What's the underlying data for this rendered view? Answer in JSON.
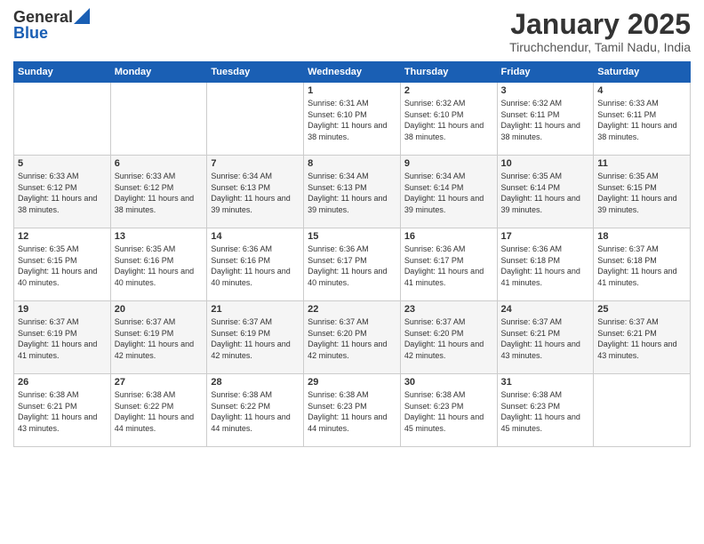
{
  "header": {
    "logo_general": "General",
    "logo_blue": "Blue",
    "month": "January 2025",
    "location": "Tiruchchendur, Tamil Nadu, India"
  },
  "days_of_week": [
    "Sunday",
    "Monday",
    "Tuesday",
    "Wednesday",
    "Thursday",
    "Friday",
    "Saturday"
  ],
  "weeks": [
    [
      {
        "day": "",
        "text": ""
      },
      {
        "day": "",
        "text": ""
      },
      {
        "day": "",
        "text": ""
      },
      {
        "day": "1",
        "text": "Sunrise: 6:31 AM\nSunset: 6:10 PM\nDaylight: 11 hours\nand 38 minutes."
      },
      {
        "day": "2",
        "text": "Sunrise: 6:32 AM\nSunset: 6:10 PM\nDaylight: 11 hours\nand 38 minutes."
      },
      {
        "day": "3",
        "text": "Sunrise: 6:32 AM\nSunset: 6:11 PM\nDaylight: 11 hours\nand 38 minutes."
      },
      {
        "day": "4",
        "text": "Sunrise: 6:33 AM\nSunset: 6:11 PM\nDaylight: 11 hours\nand 38 minutes."
      }
    ],
    [
      {
        "day": "5",
        "text": "Sunrise: 6:33 AM\nSunset: 6:12 PM\nDaylight: 11 hours\nand 38 minutes."
      },
      {
        "day": "6",
        "text": "Sunrise: 6:33 AM\nSunset: 6:12 PM\nDaylight: 11 hours\nand 38 minutes."
      },
      {
        "day": "7",
        "text": "Sunrise: 6:34 AM\nSunset: 6:13 PM\nDaylight: 11 hours\nand 39 minutes."
      },
      {
        "day": "8",
        "text": "Sunrise: 6:34 AM\nSunset: 6:13 PM\nDaylight: 11 hours\nand 39 minutes."
      },
      {
        "day": "9",
        "text": "Sunrise: 6:34 AM\nSunset: 6:14 PM\nDaylight: 11 hours\nand 39 minutes."
      },
      {
        "day": "10",
        "text": "Sunrise: 6:35 AM\nSunset: 6:14 PM\nDaylight: 11 hours\nand 39 minutes."
      },
      {
        "day": "11",
        "text": "Sunrise: 6:35 AM\nSunset: 6:15 PM\nDaylight: 11 hours\nand 39 minutes."
      }
    ],
    [
      {
        "day": "12",
        "text": "Sunrise: 6:35 AM\nSunset: 6:15 PM\nDaylight: 11 hours\nand 40 minutes."
      },
      {
        "day": "13",
        "text": "Sunrise: 6:35 AM\nSunset: 6:16 PM\nDaylight: 11 hours\nand 40 minutes."
      },
      {
        "day": "14",
        "text": "Sunrise: 6:36 AM\nSunset: 6:16 PM\nDaylight: 11 hours\nand 40 minutes."
      },
      {
        "day": "15",
        "text": "Sunrise: 6:36 AM\nSunset: 6:17 PM\nDaylight: 11 hours\nand 40 minutes."
      },
      {
        "day": "16",
        "text": "Sunrise: 6:36 AM\nSunset: 6:17 PM\nDaylight: 11 hours\nand 41 minutes."
      },
      {
        "day": "17",
        "text": "Sunrise: 6:36 AM\nSunset: 6:18 PM\nDaylight: 11 hours\nand 41 minutes."
      },
      {
        "day": "18",
        "text": "Sunrise: 6:37 AM\nSunset: 6:18 PM\nDaylight: 11 hours\nand 41 minutes."
      }
    ],
    [
      {
        "day": "19",
        "text": "Sunrise: 6:37 AM\nSunset: 6:19 PM\nDaylight: 11 hours\nand 41 minutes."
      },
      {
        "day": "20",
        "text": "Sunrise: 6:37 AM\nSunset: 6:19 PM\nDaylight: 11 hours\nand 42 minutes."
      },
      {
        "day": "21",
        "text": "Sunrise: 6:37 AM\nSunset: 6:19 PM\nDaylight: 11 hours\nand 42 minutes."
      },
      {
        "day": "22",
        "text": "Sunrise: 6:37 AM\nSunset: 6:20 PM\nDaylight: 11 hours\nand 42 minutes."
      },
      {
        "day": "23",
        "text": "Sunrise: 6:37 AM\nSunset: 6:20 PM\nDaylight: 11 hours\nand 42 minutes."
      },
      {
        "day": "24",
        "text": "Sunrise: 6:37 AM\nSunset: 6:21 PM\nDaylight: 11 hours\nand 43 minutes."
      },
      {
        "day": "25",
        "text": "Sunrise: 6:37 AM\nSunset: 6:21 PM\nDaylight: 11 hours\nand 43 minutes."
      }
    ],
    [
      {
        "day": "26",
        "text": "Sunrise: 6:38 AM\nSunset: 6:21 PM\nDaylight: 11 hours\nand 43 minutes."
      },
      {
        "day": "27",
        "text": "Sunrise: 6:38 AM\nSunset: 6:22 PM\nDaylight: 11 hours\nand 44 minutes."
      },
      {
        "day": "28",
        "text": "Sunrise: 6:38 AM\nSunset: 6:22 PM\nDaylight: 11 hours\nand 44 minutes."
      },
      {
        "day": "29",
        "text": "Sunrise: 6:38 AM\nSunset: 6:23 PM\nDaylight: 11 hours\nand 44 minutes."
      },
      {
        "day": "30",
        "text": "Sunrise: 6:38 AM\nSunset: 6:23 PM\nDaylight: 11 hours\nand 45 minutes."
      },
      {
        "day": "31",
        "text": "Sunrise: 6:38 AM\nSunset: 6:23 PM\nDaylight: 11 hours\nand 45 minutes."
      },
      {
        "day": "",
        "text": ""
      }
    ]
  ]
}
